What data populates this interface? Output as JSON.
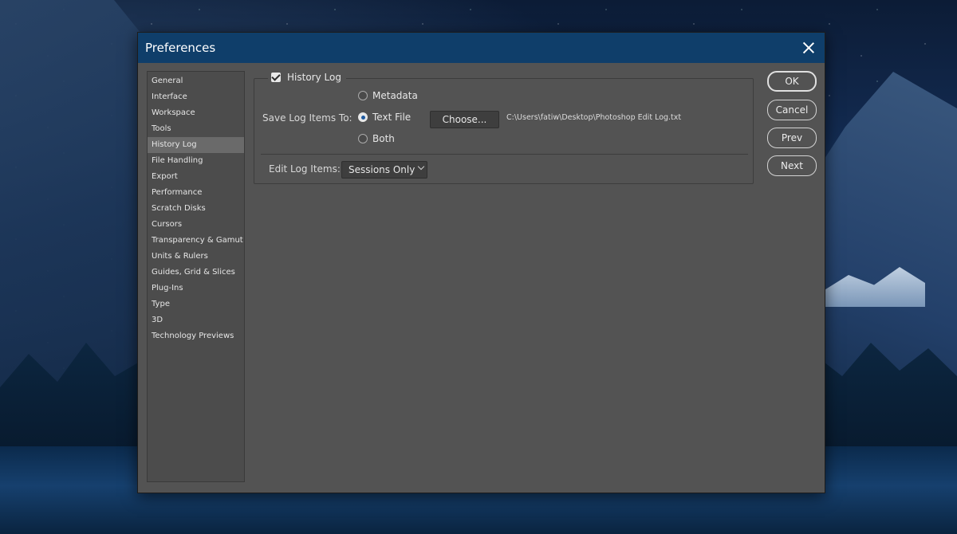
{
  "window": {
    "title": "Preferences"
  },
  "sidebar": {
    "items": [
      {
        "label": "General"
      },
      {
        "label": "Interface"
      },
      {
        "label": "Workspace"
      },
      {
        "label": "Tools"
      },
      {
        "label": "History Log"
      },
      {
        "label": "File Handling"
      },
      {
        "label": "Export"
      },
      {
        "label": "Performance"
      },
      {
        "label": "Scratch Disks"
      },
      {
        "label": "Cursors"
      },
      {
        "label": "Transparency & Gamut"
      },
      {
        "label": "Units & Rulers"
      },
      {
        "label": "Guides, Grid & Slices"
      },
      {
        "label": "Plug-Ins"
      },
      {
        "label": "Type"
      },
      {
        "label": "3D"
      },
      {
        "label": "Technology Previews"
      }
    ],
    "selected": "History Log"
  },
  "history_log": {
    "enabled": true,
    "group_label": "History Log",
    "save_to_label": "Save Log Items To:",
    "options": [
      {
        "label": "Metadata",
        "checked": false
      },
      {
        "label": "Text File",
        "checked": true
      },
      {
        "label": "Both",
        "checked": false
      }
    ],
    "choose_label": "Choose...",
    "file_path": "C:\\Users\\fatiw\\Desktop\\Photoshop Edit Log.txt",
    "edit_items_label": "Edit Log Items:",
    "edit_items_value": "Sessions Only"
  },
  "buttons": {
    "ok": "OK",
    "cancel": "Cancel",
    "prev": "Prev",
    "next": "Next"
  },
  "colors": {
    "titlebar": "#0f3e6a",
    "dialog_bg": "#535353",
    "radio_accent": "#1e5aa0"
  }
}
